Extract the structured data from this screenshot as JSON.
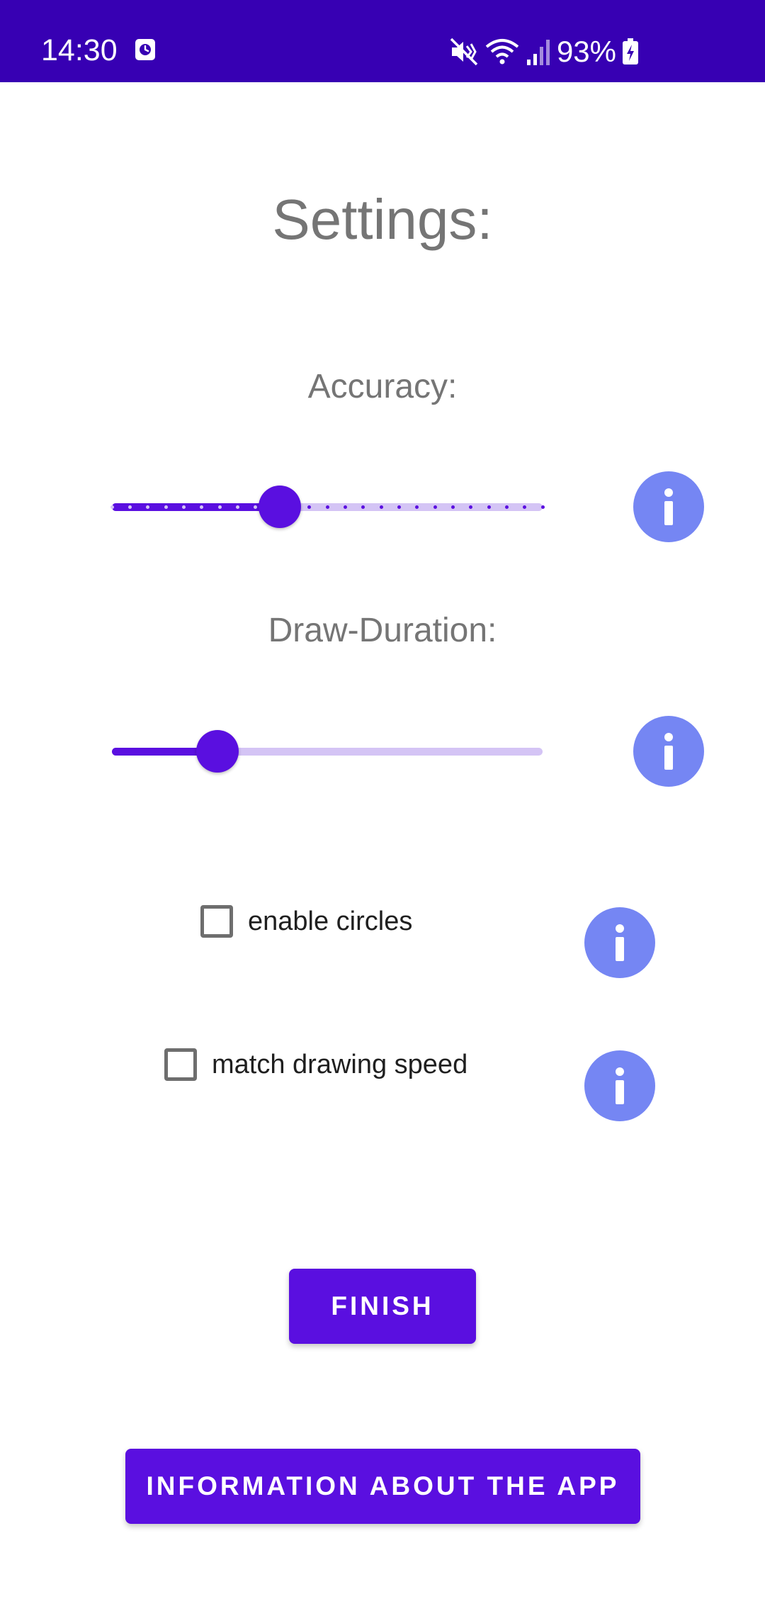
{
  "status_bar": {
    "time": "14:30",
    "battery_percent": "93%",
    "background_color": "#3700b3",
    "icons": [
      "alarm-icon",
      "mute-icon",
      "wifi-icon",
      "signal-icon",
      "battery-charging-icon"
    ]
  },
  "page": {
    "title": "Settings:"
  },
  "accuracy": {
    "label": "Accuracy:",
    "value_fraction": 0.39,
    "tick_count": 25,
    "info_icon": "info-icon"
  },
  "draw_duration": {
    "label": "Draw-Duration:",
    "value_fraction": 0.245,
    "info_icon": "info-icon"
  },
  "options": {
    "enable_circles": {
      "label": "enable circles",
      "checked": false
    },
    "match_drawing_speed": {
      "label": "match drawing speed",
      "checked": false
    }
  },
  "buttons": {
    "finish": "FINISH",
    "info_about_app": "INFORMATION ABOUT THE APP"
  },
  "colors": {
    "accent": "#5a0fe0",
    "track_inactive": "#d4c4f5",
    "info_button": "#7586f3",
    "text_secondary": "#757575"
  }
}
